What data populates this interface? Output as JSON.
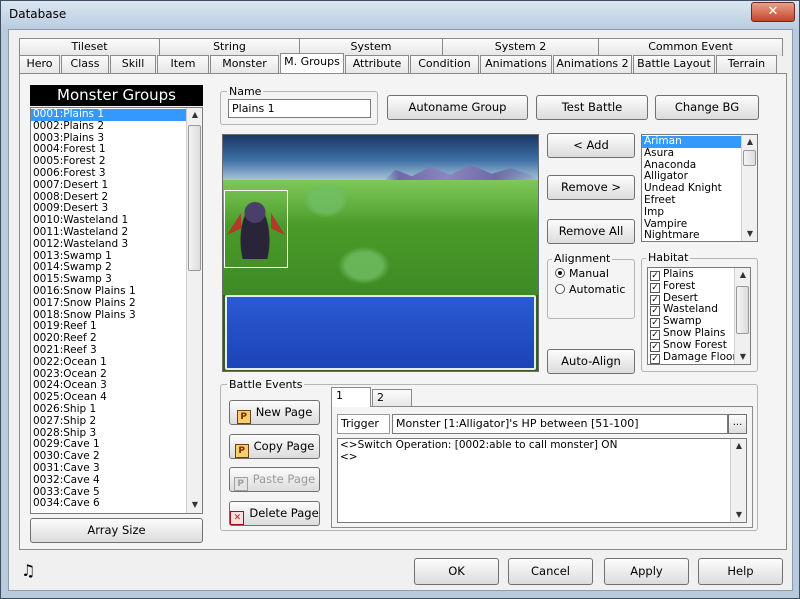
{
  "window": {
    "title": "Database",
    "close_glyph": "✕"
  },
  "tabs_row1": [
    "Tileset",
    "String",
    "System",
    "System 2",
    "Common Event"
  ],
  "tabs_row2": [
    "Hero",
    "Class",
    "Skill",
    "Item",
    "Monster",
    "M. Groups",
    "Attribute",
    "Condition",
    "Animations",
    "Animations 2",
    "Battle Layout",
    "Terrain"
  ],
  "active_tab": "M. Groups",
  "groups": {
    "title": "Monster Groups",
    "items": [
      "0001:Plains 1",
      "0002:Plains 2",
      "0003:Plains 3",
      "0004:Forest 1",
      "0005:Forest 2",
      "0006:Forest 3",
      "0007:Desert 1",
      "0008:Desert 2",
      "0009:Desert 3",
      "0010:Wasteland 1",
      "0011:Wasteland 2",
      "0012:Wasteland 3",
      "0013:Swamp 1",
      "0014:Swamp 2",
      "0015:Swamp 3",
      "0016:Snow Plains 1",
      "0017:Snow Plains 2",
      "0018:Snow Plains 3",
      "0019:Reef 1",
      "0020:Reef 2",
      "0021:Reef 3",
      "0022:Ocean 1",
      "0023:Ocean 2",
      "0024:Ocean 3",
      "0025:Ocean 4",
      "0026:Ship 1",
      "0027:Ship 2",
      "0028:Ship 3",
      "0029:Cave 1",
      "0030:Cave 2",
      "0031:Cave 3",
      "0032:Cave 4",
      "0033:Cave 5",
      "0034:Cave 6"
    ],
    "array_size_label": "Array Size"
  },
  "name_field": {
    "label": "Name",
    "value": "Plains 1"
  },
  "buttons": {
    "autoname": "Autoname Group",
    "test_battle": "Test Battle",
    "change_bg": "Change BG",
    "add": "< Add",
    "remove": "Remove >",
    "remove_all": "Remove All",
    "auto_align": "Auto-Align"
  },
  "monsters": [
    "Ariman",
    "Asura",
    "Anaconda",
    "Alligator",
    "Undead Knight",
    "Efreet",
    "Imp",
    "Vampire",
    "Nightmare"
  ],
  "alignment": {
    "label": "Alignment",
    "options": [
      "Manual",
      "Automatic"
    ],
    "selected": "Manual"
  },
  "habitat": {
    "label": "Habitat",
    "items": [
      "Plains",
      "Forest",
      "Desert",
      "Wasteland",
      "Swamp",
      "Snow Plains",
      "Snow Forest",
      "Damage Floor"
    ]
  },
  "battle_events": {
    "label": "Battle Events",
    "new_page": "New Page",
    "copy_page": "Copy Page",
    "paste_page": "Paste Page",
    "delete_page": "Delete Page",
    "pages": [
      "1",
      "2"
    ],
    "trigger_label": "Trigger",
    "trigger_value": "Monster [1:Alligator]'s HP between [51-100]",
    "trigger_btn": "...",
    "commands": [
      "<>Switch Operation: [0002:able to call monster] ON",
      "<>"
    ]
  },
  "footer": {
    "ok": "OK",
    "cancel": "Cancel",
    "apply": "Apply",
    "help": "Help"
  },
  "colors": {
    "listbox_selection": "#3399ff",
    "sky_top": "#1b3766",
    "grass": "#4a9b2a",
    "message_box": "#1d44b8"
  }
}
